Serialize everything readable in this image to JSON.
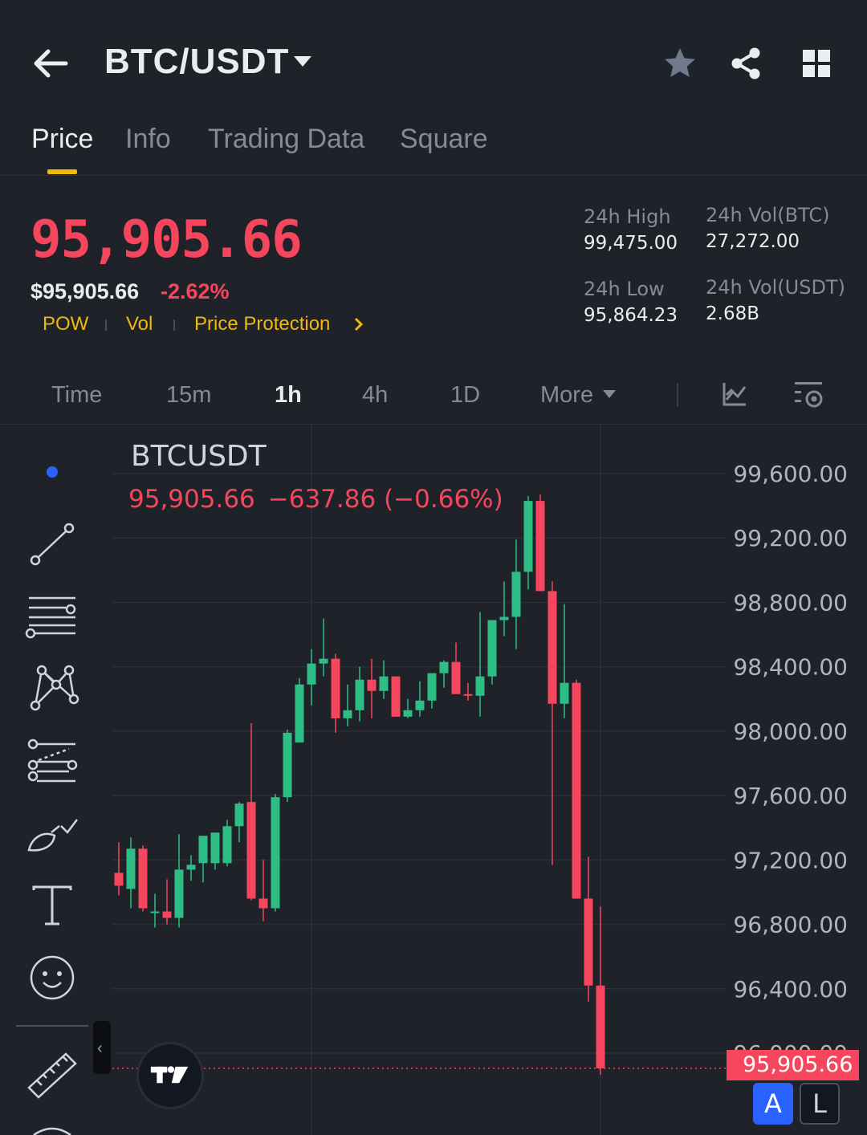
{
  "header": {
    "title": "BTC/USDT",
    "icons": [
      "back-arrow-icon",
      "chevron-down-icon",
      "star-icon",
      "share-icon",
      "grid-icon"
    ]
  },
  "tabs": [
    {
      "label": "Price",
      "active": true
    },
    {
      "label": "Info",
      "active": false
    },
    {
      "label": "Trading Data",
      "active": false
    },
    {
      "label": "Square",
      "active": false
    }
  ],
  "price": {
    "last": "95,905.66",
    "usd": "$95,905.66",
    "change_pct": "-2.62%",
    "tags": [
      "POW",
      "Vol",
      "Price Protection"
    ]
  },
  "stats": {
    "high_label": "24h High",
    "high": "99,475.00",
    "low_label": "24h Low",
    "low": "95,864.23",
    "vol_btc_label": "24h Vol(BTC)",
    "vol_btc": "27,272.00",
    "vol_usdt_label": "24h Vol(USDT)",
    "vol_usdt": "2.68B"
  },
  "intervals": [
    {
      "label": "Time",
      "active": false
    },
    {
      "label": "15m",
      "active": false
    },
    {
      "label": "1h",
      "active": true
    },
    {
      "label": "4h",
      "active": false
    },
    {
      "label": "1D",
      "active": false
    },
    {
      "label": "More",
      "active": false
    }
  ],
  "chart": {
    "symbol": "BTCUSDT",
    "ohlc_price": "95,905.66",
    "ohlc_change": "−637.86 (−0.66%)",
    "last_price_tag": "95,905.66",
    "btn_a": "A",
    "btn_l": "L"
  },
  "colors": {
    "up": "#2ebd85",
    "down": "#f6465d",
    "accent": "#f0b90b",
    "background": "#1f2229"
  },
  "chart_data": {
    "type": "candlestick",
    "yticks": [
      99600,
      99200,
      98800,
      98400,
      98000,
      97600,
      97200,
      96800,
      96400,
      96000
    ],
    "ytick_labels": [
      "99,600.00",
      "99,200.00",
      "98,800.00",
      "98,400.00",
      "98,000.00",
      "97,600.00",
      "97,200.00",
      "96,800.00",
      "96,400.00",
      "96,000.00"
    ],
    "ylim": [
      95600,
      99800
    ],
    "last_price": 95905.66,
    "candles": [
      {
        "o": 97120,
        "h": 97310,
        "l": 96980,
        "c": 97040
      },
      {
        "o": 97020,
        "h": 97340,
        "l": 96900,
        "c": 97270
      },
      {
        "o": 97270,
        "h": 97290,
        "l": 96880,
        "c": 96900
      },
      {
        "o": 96880,
        "h": 96990,
        "l": 96780,
        "c": 96880
      },
      {
        "o": 96880,
        "h": 97080,
        "l": 96800,
        "c": 96840
      },
      {
        "o": 96840,
        "h": 97360,
        "l": 96780,
        "c": 97140
      },
      {
        "o": 97140,
        "h": 97230,
        "l": 97070,
        "c": 97170
      },
      {
        "o": 97180,
        "h": 97350,
        "l": 97060,
        "c": 97350
      },
      {
        "o": 97180,
        "h": 97370,
        "l": 97140,
        "c": 97370
      },
      {
        "o": 97180,
        "h": 97450,
        "l": 97160,
        "c": 97410
      },
      {
        "o": 97410,
        "h": 97560,
        "l": 97310,
        "c": 97550
      },
      {
        "o": 97560,
        "h": 98050,
        "l": 96950,
        "c": 96960
      },
      {
        "o": 96960,
        "h": 97200,
        "l": 96820,
        "c": 96900
      },
      {
        "o": 96900,
        "h": 97610,
        "l": 96880,
        "c": 97590
      },
      {
        "o": 97590,
        "h": 98010,
        "l": 97560,
        "c": 97990
      },
      {
        "o": 97930,
        "h": 98330,
        "l": 97930,
        "c": 98290
      },
      {
        "o": 98290,
        "h": 98510,
        "l": 98160,
        "c": 98420
      },
      {
        "o": 98420,
        "h": 98700,
        "l": 98340,
        "c": 98450
      },
      {
        "o": 98450,
        "h": 98480,
        "l": 97990,
        "c": 98080
      },
      {
        "o": 98080,
        "h": 98290,
        "l": 98030,
        "c": 98130
      },
      {
        "o": 98130,
        "h": 98400,
        "l": 98060,
        "c": 98320
      },
      {
        "o": 98320,
        "h": 98450,
        "l": 98080,
        "c": 98250
      },
      {
        "o": 98250,
        "h": 98440,
        "l": 98200,
        "c": 98340
      },
      {
        "o": 98340,
        "h": 98340,
        "l": 98090,
        "c": 98090
      },
      {
        "o": 98090,
        "h": 98200,
        "l": 98080,
        "c": 98130
      },
      {
        "o": 98130,
        "h": 98310,
        "l": 98090,
        "c": 98190
      },
      {
        "o": 98190,
        "h": 98350,
        "l": 98140,
        "c": 98360
      },
      {
        "o": 98360,
        "h": 98440,
        "l": 98270,
        "c": 98430
      },
      {
        "o": 98430,
        "h": 98550,
        "l": 98230,
        "c": 98230
      },
      {
        "o": 98230,
        "h": 98300,
        "l": 98190,
        "c": 98220
      },
      {
        "o": 98220,
        "h": 98740,
        "l": 98090,
        "c": 98340
      },
      {
        "o": 98340,
        "h": 98610,
        "l": 98290,
        "c": 98690
      },
      {
        "o": 98690,
        "h": 98930,
        "l": 98590,
        "c": 98710
      },
      {
        "o": 98710,
        "h": 99190,
        "l": 98510,
        "c": 98990
      },
      {
        "o": 98990,
        "h": 99460,
        "l": 98880,
        "c": 99430
      },
      {
        "o": 99430,
        "h": 99470,
        "l": 98870,
        "c": 98870
      },
      {
        "o": 98870,
        "h": 98930,
        "l": 97170,
        "c": 98170
      },
      {
        "o": 98170,
        "h": 98790,
        "l": 98080,
        "c": 98300
      },
      {
        "o": 98300,
        "h": 98320,
        "l": 96960,
        "c": 96960
      },
      {
        "o": 96960,
        "h": 97220,
        "l": 96320,
        "c": 96420
      },
      {
        "o": 96420,
        "h": 96910,
        "l": 95866,
        "c": 95905.66
      }
    ]
  }
}
